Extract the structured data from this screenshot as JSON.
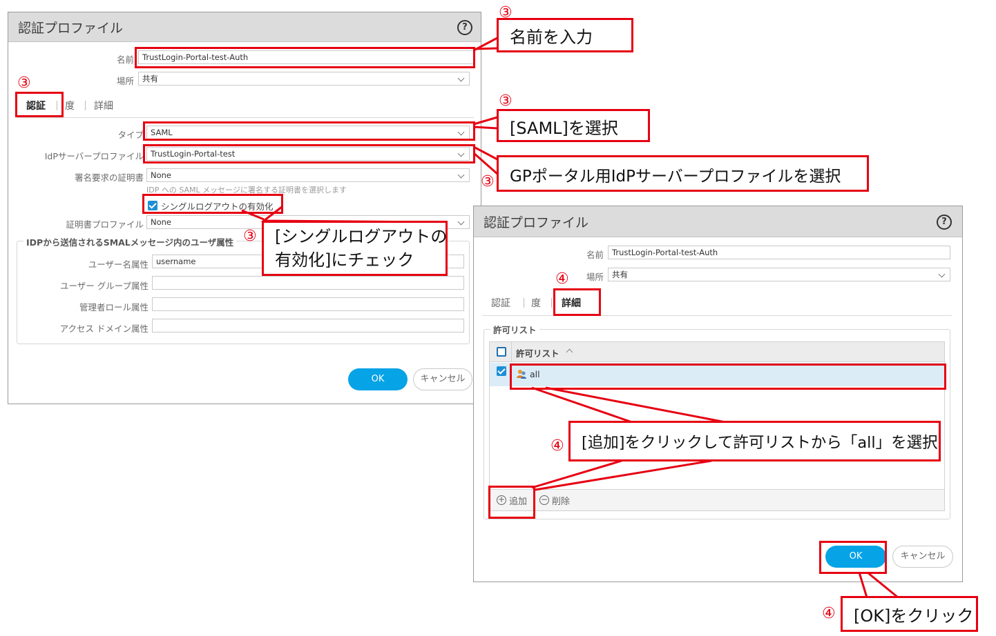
{
  "dialog1": {
    "title": "認証プロファイル",
    "name_label": "名前",
    "name_value": "TrustLogin-Portal-test-Auth",
    "location_label": "場所",
    "location_value": "共有",
    "tabs": [
      "認証",
      "度",
      "詳細"
    ],
    "type_label": "タイプ",
    "type_value": "SAML",
    "idp_label": "IdPサーバープロファイル",
    "idp_value": "TrustLogin-Portal-test",
    "sign_cert_label": "署名要求の証明書",
    "sign_cert_value": "None",
    "sign_cert_hint": "IDP への SAML メッセージに署名する証明書を選択します",
    "slo_label": "シングルログアウトの有効化",
    "slo_checked": true,
    "cert_profile_label": "証明書プロファイル",
    "cert_profile_value": "None",
    "attr_section_title": "IDPから送信されるSMALメッセージ内のユーザ属性",
    "username_attr_label": "ユーザー名属性",
    "username_attr_value": "username",
    "group_attr_label": "ユーザー グループ属性",
    "admin_role_label": "管理者ロール属性",
    "access_domain_label": "アクセス ドメイン属性",
    "ok_label": "OK",
    "cancel_label": "キャンセル"
  },
  "dialog2": {
    "title": "認証プロファイル",
    "name_label": "名前",
    "name_value": "TrustLogin-Portal-test-Auth",
    "location_label": "場所",
    "location_value": "共有",
    "tabs": [
      "認証",
      "度",
      "詳細"
    ],
    "allow_section": "許可リスト",
    "column_header": "許可リスト",
    "rows": [
      {
        "name": "all",
        "checked": true
      }
    ],
    "add_label": "追加",
    "delete_label": "削除",
    "ok_label": "OK",
    "cancel_label": "キャンセル"
  },
  "annotations": {
    "step3": "③",
    "step4": "④",
    "enter_name": "名前を入力",
    "select_saml": "[SAML]を選択",
    "select_idp": "GPポータル用IdPサーバープロファイルを選択",
    "check_slo_line1": "[シングルログアウトの",
    "check_slo_line2": "有効化]にチェック",
    "add_all": "[追加]をクリックして許可リストから「all」を選択",
    "click_ok": "[OK]をクリック"
  },
  "colors": {
    "annotation_red": "#e60012",
    "ok_blue": "#06a3e6",
    "check_blue": "#1e8fd6"
  }
}
